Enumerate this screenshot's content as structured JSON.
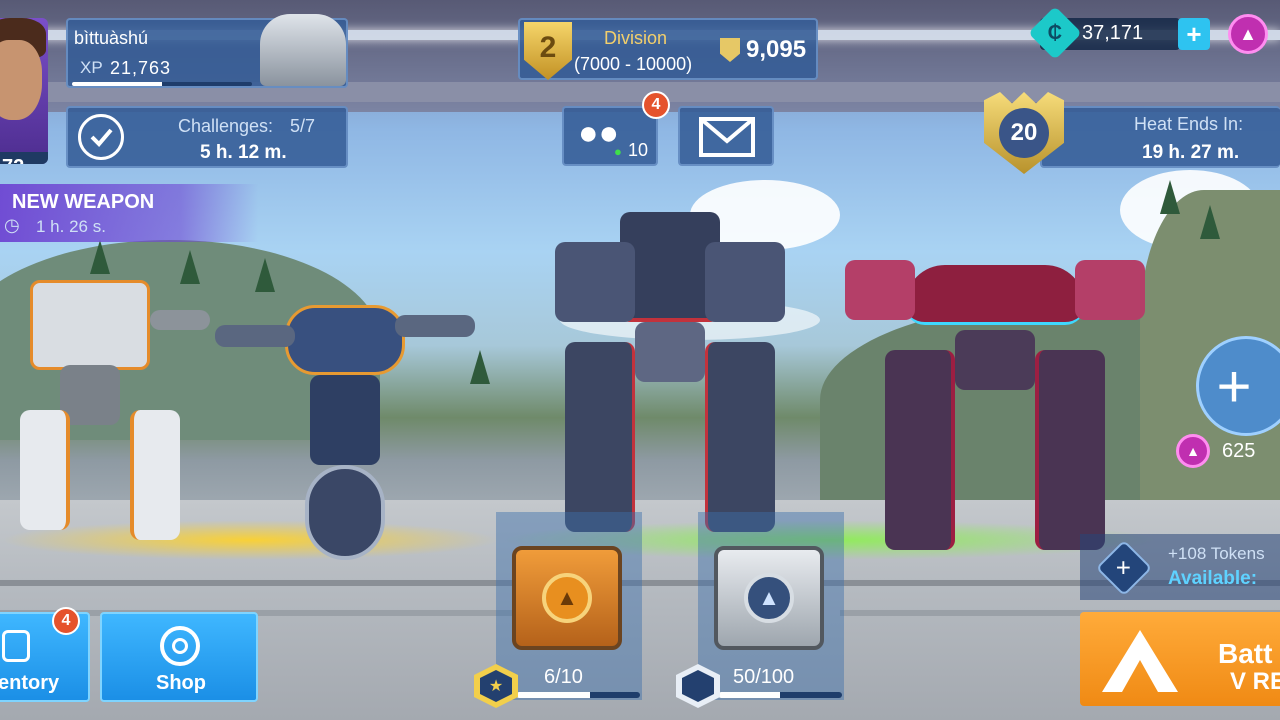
{
  "player": {
    "name": "bìttuàshú",
    "xp_label": "XP",
    "xp_value": "21,763",
    "xp_progress": 0.5,
    "level_partial": "72"
  },
  "division": {
    "rank": "2",
    "title": "Division",
    "range": "(7000 - 10000)",
    "trophies": "9,095"
  },
  "currency": {
    "credits": "37,171",
    "tokens_available": "625"
  },
  "challenges": {
    "label": "Challenges:",
    "progress": "5/7",
    "time": "5 h. 12 m."
  },
  "friends": {
    "online_count": "10",
    "notification_count": "4"
  },
  "heat": {
    "level": "20",
    "label": "Heat Ends In:",
    "time": "19 h. 27 m."
  },
  "new_weapon": {
    "label": "NEW WEAPON",
    "time": "1 h. 26 s."
  },
  "tokens_banner": {
    "line1": "+108 Tokens",
    "line2": "Available:"
  },
  "boxes": {
    "gold_progress": "6/10",
    "gold_fraction": 0.6,
    "silver_progress": "50/100",
    "silver_fraction": 0.5
  },
  "nav": {
    "inventory_label": "entory",
    "inventory_badge": "4",
    "shop_label": "Shop",
    "battle_label_1": "Batt",
    "battle_label_2": "V RE"
  },
  "colors": {
    "panel": "#345c96",
    "accent_blue": "#3fb7ff",
    "accent_orange": "#f08a14",
    "notification": "#e5532d",
    "token_purple": "#c02fb0"
  }
}
